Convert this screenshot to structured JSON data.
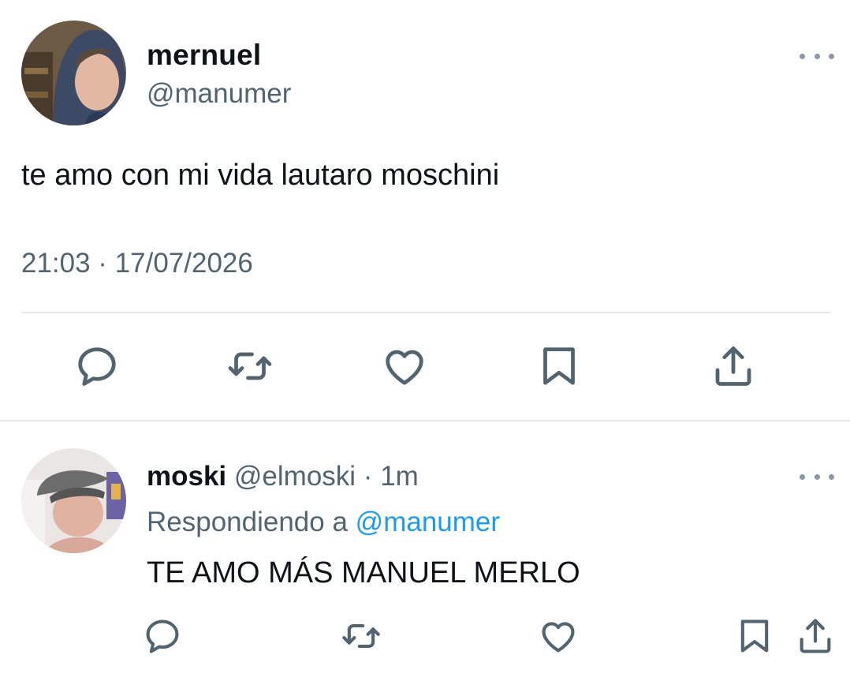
{
  "main_tweet": {
    "author_name": "mernuel",
    "author_handle": "@manumer",
    "more_icon": "more-horizontal-icon",
    "text": "te amo con mi vida lautaro moschini",
    "timestamp": "21:03 · 17/07/2026",
    "actions": [
      {
        "icon": "reply-icon"
      },
      {
        "icon": "retweet-icon"
      },
      {
        "icon": "like-icon"
      },
      {
        "icon": "bookmark-icon"
      },
      {
        "icon": "share-icon"
      }
    ]
  },
  "reply": {
    "author_name": "moski",
    "author_handle": "@elmoski",
    "separator": "·",
    "time": "1m",
    "replying_label": "Respondiendo a",
    "replying_to": "@manumer",
    "text": "TE AMO MÁS MANUEL MERLO",
    "more_icon": "more-horizontal-icon",
    "actions": [
      {
        "icon": "reply-icon"
      },
      {
        "icon": "retweet-icon"
      },
      {
        "icon": "like-icon"
      },
      {
        "icon": "bookmark-icon"
      },
      {
        "icon": "share-icon"
      }
    ]
  },
  "colors": {
    "text_primary": "#0f1419",
    "text_secondary": "#536471",
    "accent": "#1d9bf0",
    "divider": "#e7e9ea"
  }
}
